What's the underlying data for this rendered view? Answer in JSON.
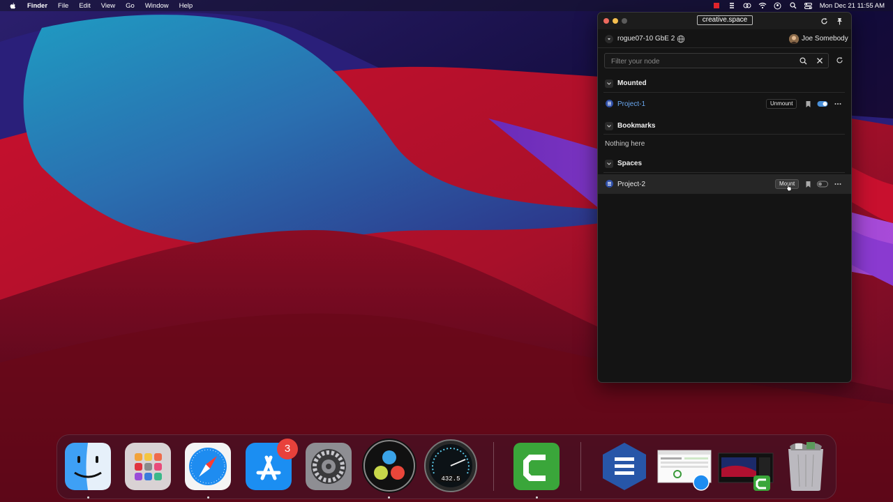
{
  "menubar": {
    "app_name": "Finder",
    "menus": [
      "File",
      "Edit",
      "View",
      "Go",
      "Window",
      "Help"
    ],
    "clock": "Mon Dec 21  11:55 AM"
  },
  "window": {
    "title": "creative.space",
    "node_name": "rogue07-10 GbE 2",
    "user_name": "Joe Somebody",
    "search_placeholder": "Filter your node",
    "sections": {
      "mounted": {
        "title": "Mounted",
        "items": [
          {
            "name": "Project-1",
            "action": "Unmount",
            "enabled": true
          }
        ]
      },
      "bookmarks": {
        "title": "Bookmarks",
        "empty_text": "Nothing here"
      },
      "spaces": {
        "title": "Spaces",
        "items": [
          {
            "name": "Project-2",
            "action": "Mount",
            "enabled": false
          }
        ]
      }
    }
  },
  "dock": {
    "apps": [
      "Finder",
      "Launchpad",
      "Safari",
      "App Store",
      "System Preferences",
      "DaVinci Resolve",
      "Disk Speed Test",
      "Camtasia",
      "creative.space",
      "Downloads stack",
      "Recent windows",
      "Trash"
    ],
    "app_store_badge": "3",
    "speedometer_reading": "432.5"
  },
  "colors": {
    "accent_blue": "#6aa8f0",
    "window_bg": "#141414",
    "badge_red": "#e8413b"
  }
}
